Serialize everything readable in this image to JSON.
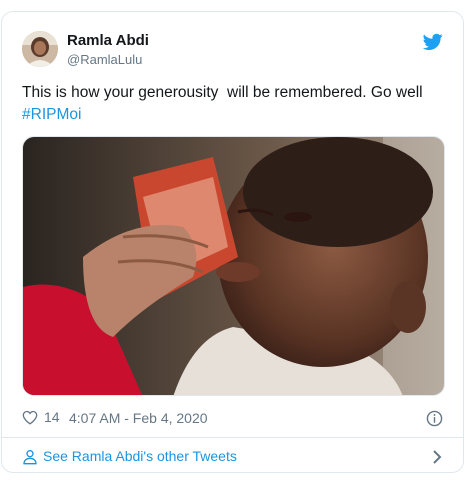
{
  "tweet": {
    "author": {
      "display_name": "Ramla Abdi",
      "handle": "@RamlaLulu"
    },
    "text": "This is how your generousity  will be remembered. Go well ",
    "hashtag": "#RIPMoi",
    "likes": "14",
    "timestamp": "4:07 AM - Feb 4, 2020",
    "more_tweets_label": "See Ramla Abdi's other Tweets"
  },
  "icons": {
    "brand": "twitter-bird-icon",
    "like": "heart-icon",
    "info": "info-icon",
    "profile": "person-icon",
    "chevron": "chevron-right-icon"
  },
  "colors": {
    "link": "#1b95e0",
    "muted": "#657786",
    "border": "#e1e8ed",
    "twitter_blue": "#1da1f2"
  }
}
